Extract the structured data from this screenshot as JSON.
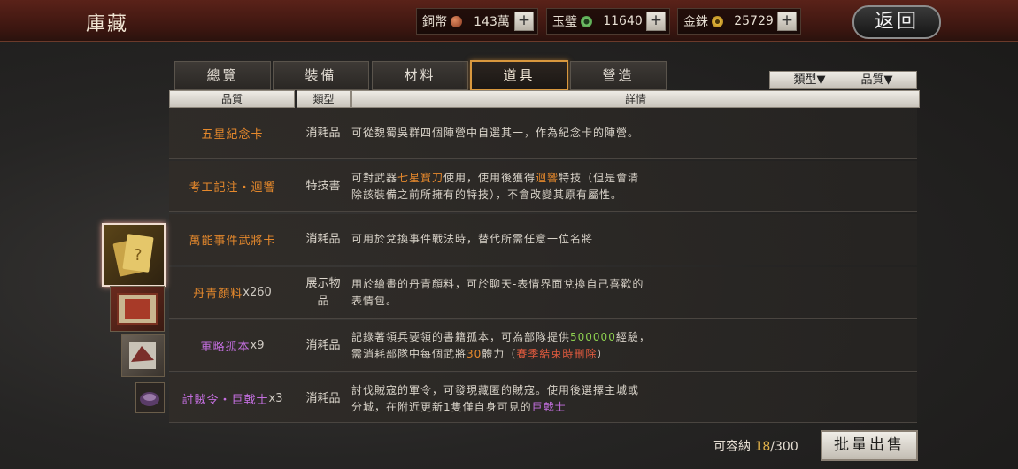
{
  "header": {
    "title": "庫藏",
    "resources": [
      {
        "label": "銅幣",
        "value": "143萬",
        "icon": "copper-coin-icon",
        "color": "#b05a35"
      },
      {
        "label": "玉璧",
        "value": "11640",
        "icon": "jade-disc-icon",
        "color": "#6fbf6a"
      },
      {
        "label": "金銖",
        "value": "25729",
        "icon": "gold-coin-icon",
        "color": "#d2a630"
      }
    ],
    "plus_label": "+",
    "back_label": "返回"
  },
  "tabs": [
    {
      "label": "總覽",
      "active": false
    },
    {
      "label": "裝備",
      "active": false
    },
    {
      "label": "材料",
      "active": false
    },
    {
      "label": "道具",
      "active": true
    },
    {
      "label": "營造",
      "active": false
    }
  ],
  "filters": {
    "type": "類型▼",
    "quality": "品質▼"
  },
  "columns": {
    "quality": "品質",
    "type": "類型",
    "details": "詳情"
  },
  "rows": [
    {
      "name": "五星紀念卡",
      "count": "",
      "type": "消耗品",
      "desc_line1": "可從魏蜀吳群四個陣營中自選其一，作為紀念卡的陣營。",
      "desc_line2": ""
    },
    {
      "name": "考工記注・迴響",
      "count": "",
      "type": "特技書",
      "desc_a": "可對武器",
      "desc_b": "七星寶刀",
      "desc_c": "使用，使用後獲得",
      "desc_d": "迴響",
      "desc_e": "特技（但是會清",
      "desc_line2": "除該裝備之前所擁有的特技），不會改變其原有屬性。"
    },
    {
      "name": "萬能事件武將卡",
      "count": "",
      "type": "消耗品",
      "desc_line1": "可用於兌換事件戰法時，替代所需任意一位名將",
      "desc_line2": ""
    },
    {
      "name": "丹青顏料",
      "count": "x260",
      "type": "展示物品",
      "desc_line1": "用於繪畫的丹青顏料，可於聊天-表情界面兌換自己喜歡的",
      "desc_line2": "表情包。"
    },
    {
      "name": "軍略孤本",
      "count": "x9",
      "type": "消耗品",
      "desc_a": "記錄著領兵要領的書籍孤本，可為部隊提供",
      "desc_b": "500000",
      "desc_c": "經驗，",
      "desc_d": "需消耗部隊中每個武將",
      "desc_e": "30",
      "desc_f": "體力（",
      "desc_g": "賽季結束時刪除",
      "desc_h": "）"
    },
    {
      "name": "討賊令・巨戟士",
      "count": "x3",
      "type": "消耗品",
      "desc_line1": "討伐賊寇的軍令，可發現藏匿的賊寇。使用後選擇主城或",
      "desc_a": "分城，在附近更新1隻僅自身可見的",
      "desc_b": "巨戟士"
    }
  ],
  "footer": {
    "capacity_label": "可容納",
    "capacity_used": "18",
    "capacity_total": "/300",
    "sell_label": "批量出售"
  },
  "colors": {
    "orange": "#e6892c",
    "purple": "#c46fe0",
    "green": "#8ccf4f",
    "red": "#e05a3e"
  }
}
